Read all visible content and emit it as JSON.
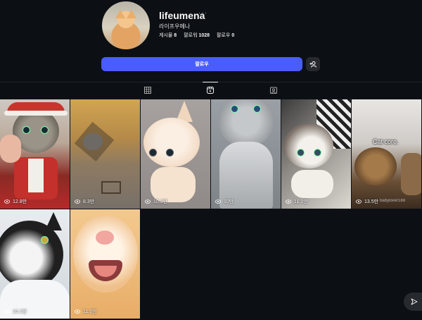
{
  "profile": {
    "username": "lifeumena",
    "more": "···",
    "full_name": "라이프우메나",
    "posts_label": "게시물",
    "posts_count": "8",
    "followers_label": "팔로워",
    "followers_count": "1028",
    "following_label": "팔로우",
    "following_count": "0"
  },
  "actions": {
    "follow_label": "팔로우",
    "add_user_icon": "add-user-icon"
  },
  "tabs": [
    {
      "name": "posts",
      "icon": "grid-icon"
    },
    {
      "name": "reels",
      "icon": "reels-icon",
      "active": true
    },
    {
      "name": "tagged",
      "icon": "tagged-icon"
    }
  ],
  "reels": [
    {
      "views": "12.8만",
      "caption": "",
      "watermark": ""
    },
    {
      "views": "8.3만",
      "caption": "",
      "watermark": ""
    },
    {
      "views": "10.3만",
      "caption": "",
      "watermark": ""
    },
    {
      "views": "10만",
      "caption": "",
      "watermark": ""
    },
    {
      "views": "11.1만",
      "caption": "",
      "watermark": ""
    },
    {
      "views": "13.5만",
      "caption": "Cat core.",
      "watermark": "babylover188"
    },
    {
      "views": "16.2만",
      "caption": "",
      "watermark": ""
    },
    {
      "views": "11.6만",
      "caption": "",
      "watermark": ""
    }
  ],
  "colors": {
    "background": "#0c1014",
    "follow_button": "#4a5df9",
    "secondary_button": "#26292d"
  }
}
